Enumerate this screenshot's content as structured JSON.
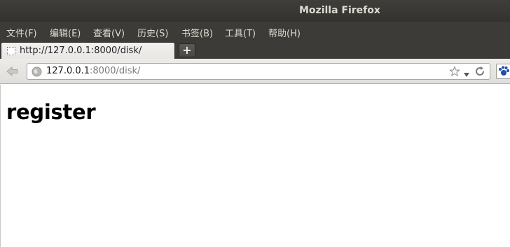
{
  "window": {
    "title": "Mozilla Firefox"
  },
  "menubar": {
    "items": [
      "文件(F)",
      "编辑(E)",
      "查看(V)",
      "历史(S)",
      "书签(B)",
      "工具(T)",
      "帮助(H)"
    ]
  },
  "tabs": [
    {
      "label": "http://127.0.0.1:8000/disk/",
      "favicon": "blank-page-icon",
      "active": true
    }
  ],
  "newtab": {
    "label": "+"
  },
  "navbar": {
    "url_host": "127.0.0.1",
    "url_rest": ":8000/disk/",
    "icons": [
      "back-arrow-icon",
      "globe-icon",
      "star-icon",
      "dropdown-icon",
      "reload-icon",
      "addon-icon"
    ]
  },
  "page": {
    "heading": "register"
  },
  "colors": {
    "titlebar": "#3c3b37",
    "titlebar_text": "#dfdbd2",
    "toolbar": "#edece9",
    "page_background": "#ffffff"
  }
}
